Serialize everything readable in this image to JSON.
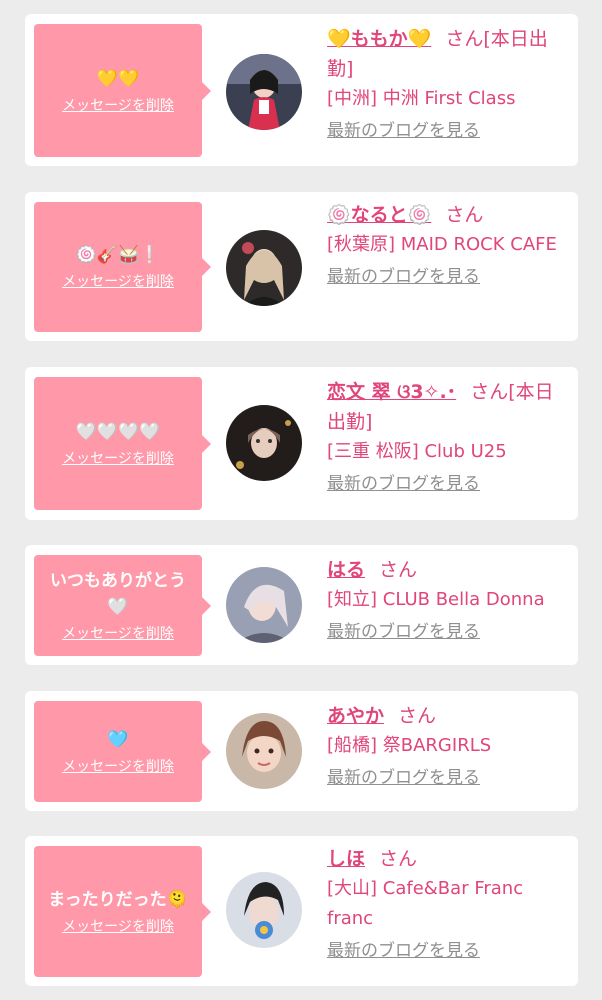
{
  "delete_label": "メッセージを削除",
  "san_label": "さん",
  "blog_label": "最新のブログを見る",
  "cards": [
    {
      "message": "💛💛",
      "name": "💛ももか💛",
      "status": "[本日出勤]",
      "shop": "[中洲] 中洲 First Class",
      "avatar_icon": "avatar-photo-icon"
    },
    {
      "message": "🍥🎸🥁❕",
      "name": "🍥なると🍥",
      "status": "",
      "shop": "[秋葉原] MAID ROCK CAFE",
      "avatar_icon": "avatar-photo-icon"
    },
    {
      "message": "🤍🤍🤍🤍",
      "name": "恋文 翠 ଓ3✧.･",
      "status": "[本日出勤]",
      "shop": "[三重 松阪] Club U25",
      "avatar_icon": "avatar-photo-icon"
    },
    {
      "message": "いつもありがとう\n🤍",
      "name": "はる",
      "status": "",
      "shop": "[知立] CLUB Bella Donna",
      "avatar_icon": "avatar-photo-icon"
    },
    {
      "message": "🩵",
      "name": "あやか",
      "status": "",
      "shop": "[船橋] 祭BARGIRLS",
      "avatar_icon": "avatar-photo-icon"
    },
    {
      "message": "まったりだった🫠",
      "name": "しほ",
      "status": "",
      "shop": "[大山] Cafe&Bar Franc franc",
      "avatar_icon": "avatar-photo-icon"
    }
  ]
}
